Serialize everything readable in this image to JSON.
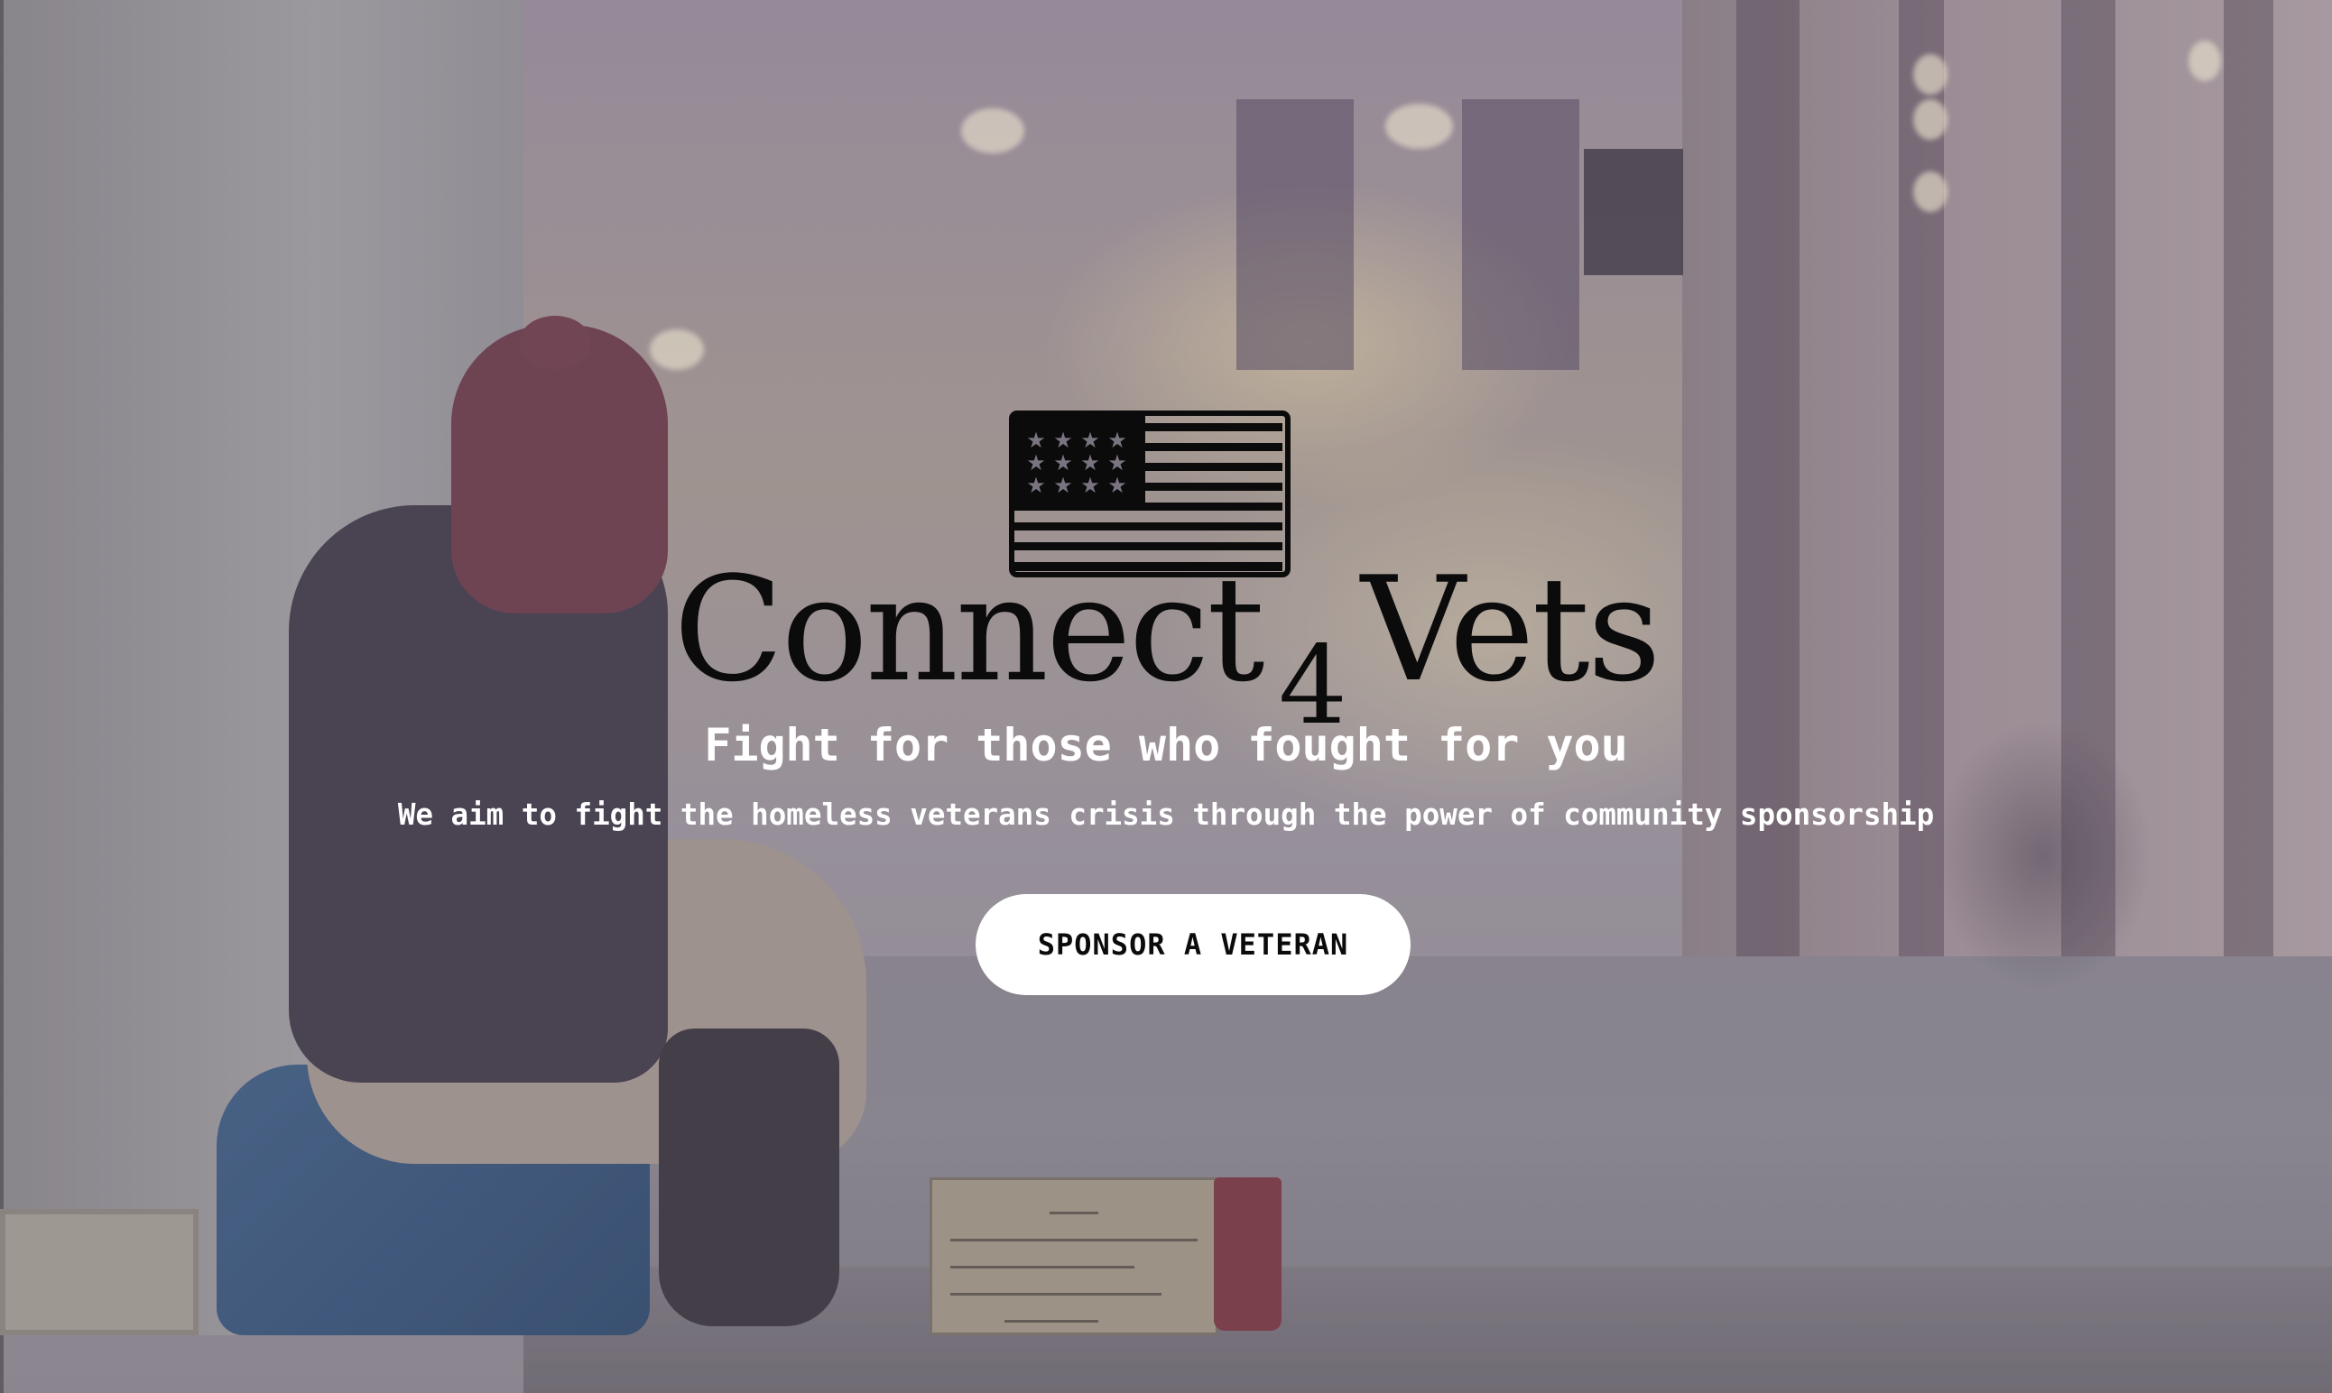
{
  "hero": {
    "brand_main": "Connect",
    "brand_number": "4",
    "brand_end": "Vets",
    "tagline": "Fight for those who fought for you",
    "subline": "We aim to fight the homeless veterans crisis through the power of community sponsorship",
    "cta_label": "SPONSOR A VETERAN"
  },
  "icons": {
    "logo": "american-flag-icon"
  },
  "colors": {
    "brand_text": "#0b0b0c",
    "tagline_text": "#ffffff",
    "button_bg": "#ffffff",
    "button_text": "#0b0b0c"
  }
}
